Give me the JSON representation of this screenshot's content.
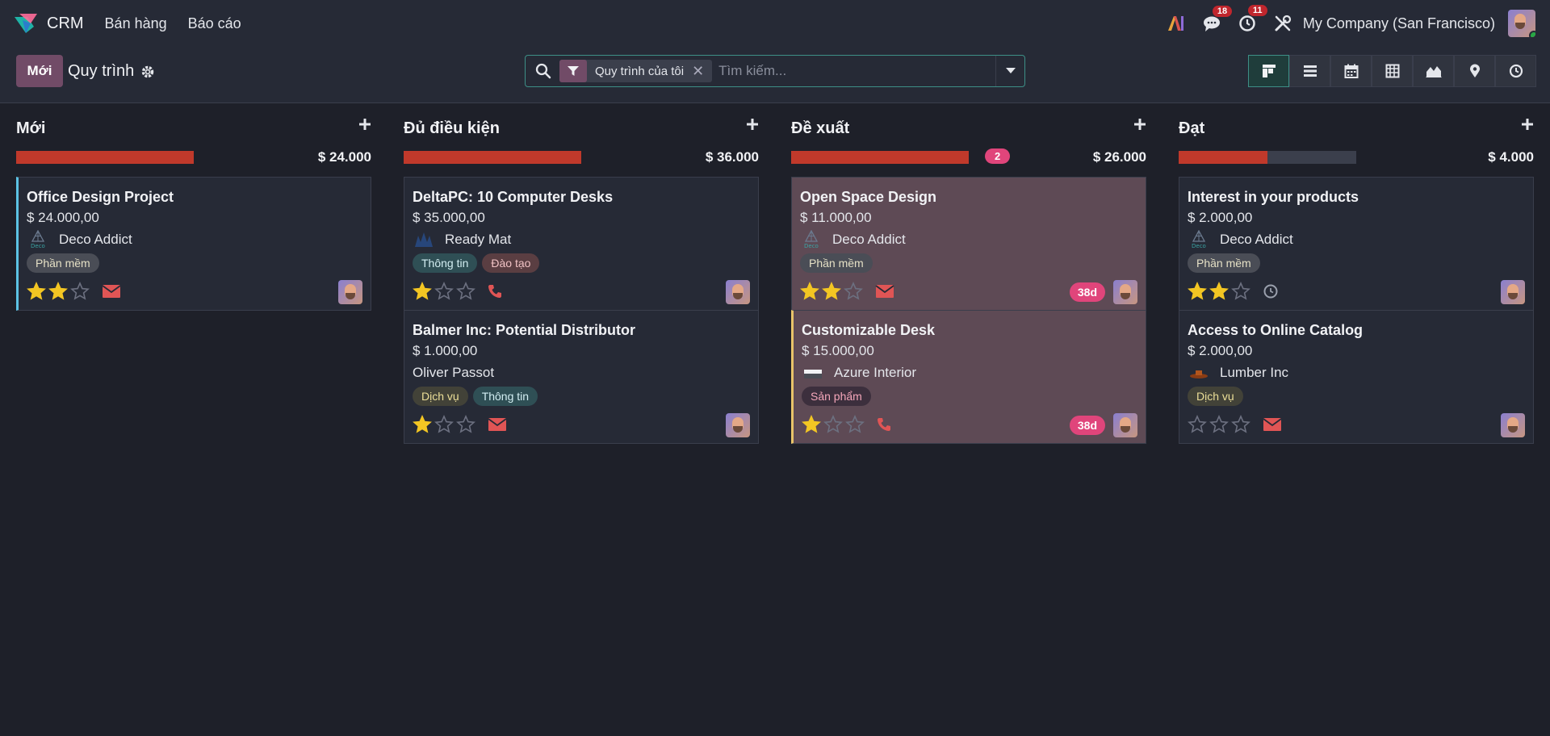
{
  "navbar": {
    "app_name": "CRM",
    "menu": [
      "Bán hàng",
      "Báo cáo"
    ],
    "messages_count": "18",
    "activities_count": "11",
    "company": "My Company (San Francisco)"
  },
  "control": {
    "new_label": "Mới",
    "title": "Quy trình",
    "facet_label": "Quy trình của tôi",
    "search_placeholder": "Tìm kiếm..."
  },
  "columns": [
    {
      "title": "Mới",
      "sum": "$ 24.000",
      "progress": 1.0,
      "count": "",
      "cards": [
        {
          "title": "Office Design Project",
          "amount": "$ 24.000,00",
          "partner": "Deco Addict",
          "tags": [
            {
              "label": "Phần mềm",
              "style": "grey"
            }
          ],
          "stars": 2,
          "activity": "email",
          "days": "",
          "style": "border-blue"
        }
      ]
    },
    {
      "title": "Đủ điều kiện",
      "sum": "$ 36.000",
      "progress": 1.0,
      "count": "",
      "cards": [
        {
          "title": "DeltaPC: 10 Computer Desks",
          "amount": "$ 35.000,00",
          "partner": "Ready Mat",
          "tags": [
            {
              "label": "Thông tin",
              "style": "teal"
            },
            {
              "label": "Đào tạo",
              "style": "red"
            }
          ],
          "stars": 1,
          "activity": "phone",
          "days": "",
          "style": ""
        },
        {
          "title": "Balmer Inc: Potential Distributor",
          "amount": "$ 1.000,00",
          "partner": "Oliver Passot",
          "tags": [
            {
              "label": "Dịch vụ",
              "style": "olive"
            },
            {
              "label": "Thông tin",
              "style": "teal"
            }
          ],
          "stars": 1,
          "activity": "email",
          "days": "",
          "style": ""
        }
      ]
    },
    {
      "title": "Đề xuất",
      "sum": "$ 26.000",
      "progress": 1.0,
      "count": "2",
      "cards": [
        {
          "title": "Open Space Design",
          "amount": "$ 11.000,00",
          "partner": "Deco Addict",
          "tags": [
            {
              "label": "Phần mềm",
              "style": "grey"
            }
          ],
          "stars": 2,
          "activity": "email",
          "days": "38d",
          "style": "pink"
        },
        {
          "title": "Customizable Desk",
          "amount": "$ 15.000,00",
          "partner": "Azure Interior",
          "tags": [
            {
              "label": "Sản phẩm",
              "style": "pink"
            }
          ],
          "stars": 1,
          "activity": "phone",
          "days": "38d",
          "style": "pink border-yellow"
        }
      ]
    },
    {
      "title": "Đạt",
      "sum": "$ 4.000",
      "progress": 0.5,
      "count": "",
      "cards": [
        {
          "title": "Interest in your products",
          "amount": "$ 2.000,00",
          "partner": "Deco Addict",
          "tags": [
            {
              "label": "Phần mềm",
              "style": "grey"
            }
          ],
          "stars": 2,
          "activity": "clock",
          "days": "",
          "style": ""
        },
        {
          "title": "Access to Online Catalog",
          "amount": "$ 2.000,00",
          "partner": "Lumber Inc",
          "tags": [
            {
              "label": "Dịch vụ",
              "style": "olive"
            }
          ],
          "stars": 0,
          "activity": "email",
          "days": "",
          "style": ""
        }
      ]
    }
  ],
  "colors": {
    "accent": "#714b67",
    "teal": "#3d8f87",
    "danger": "#c0392b",
    "badge": "#e0457b"
  },
  "icons": [
    "crm-logo-icon",
    "ai-icon",
    "chat-icon",
    "activity-clock-icon",
    "tools-icon",
    "search-icon",
    "filter-icon",
    "gear-icon",
    "kanban-icon",
    "list-icon",
    "calendar-icon",
    "pivot-icon",
    "graph-icon",
    "map-pin-icon",
    "activity-view-icon"
  ]
}
